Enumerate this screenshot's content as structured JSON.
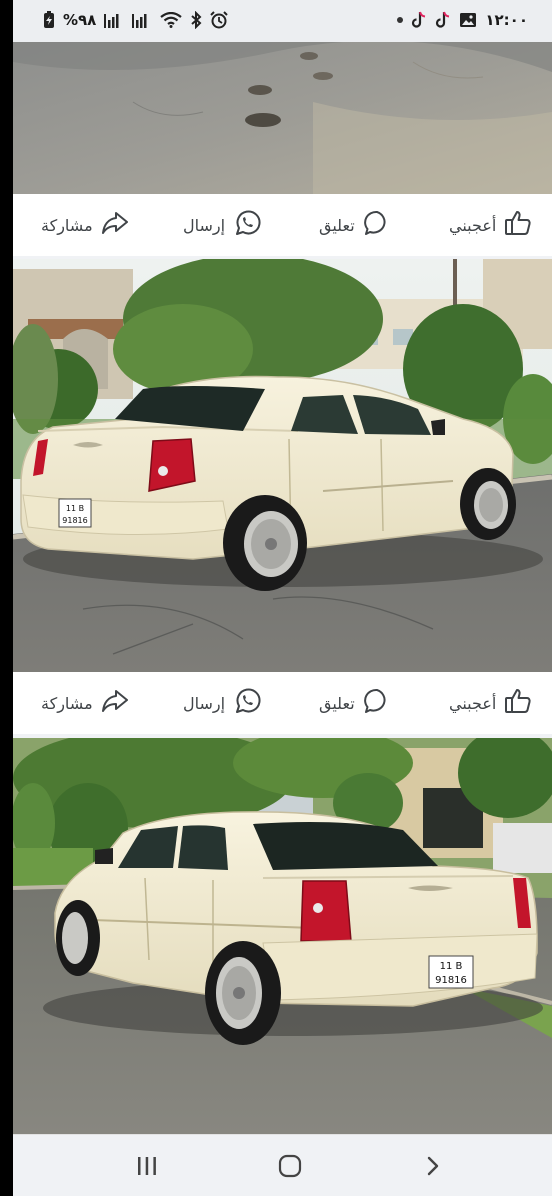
{
  "status_bar": {
    "battery": "%٩٨",
    "time": "١٢:٠٠",
    "left_icons": [
      "battery-charging-icon",
      "signal-icon",
      "signal-icon",
      "wifi-icon",
      "bluetooth-icon",
      "alarm-icon"
    ],
    "right_icons": [
      "tiktok-icon",
      "tiktok-icon",
      "gallery-icon",
      "notification-dot-icon"
    ]
  },
  "posts": [
    {
      "photo": "car-photo-1-ground",
      "actions": {
        "like": "أعجبني",
        "comment": "تعليق",
        "send": "إرسال",
        "share": "مشاركة"
      }
    },
    {
      "photo": "car-photo-2-rear-left",
      "plate": {
        "line1": "11 B",
        "line2": "91816"
      },
      "actions": {
        "like": "أعجبني",
        "comment": "تعليق",
        "send": "إرسال",
        "share": "مشاركة"
      }
    },
    {
      "photo": "car-photo-3-rear-right",
      "plate": {
        "line1": "11 B",
        "line2": "91816"
      }
    }
  ],
  "nav_bar": {
    "icons": [
      "recent-apps-icon",
      "home-icon",
      "back-icon"
    ]
  },
  "colors": {
    "action_text": "#404448",
    "car_body": "#f2ecd2",
    "background": "#f0f2f5"
  }
}
